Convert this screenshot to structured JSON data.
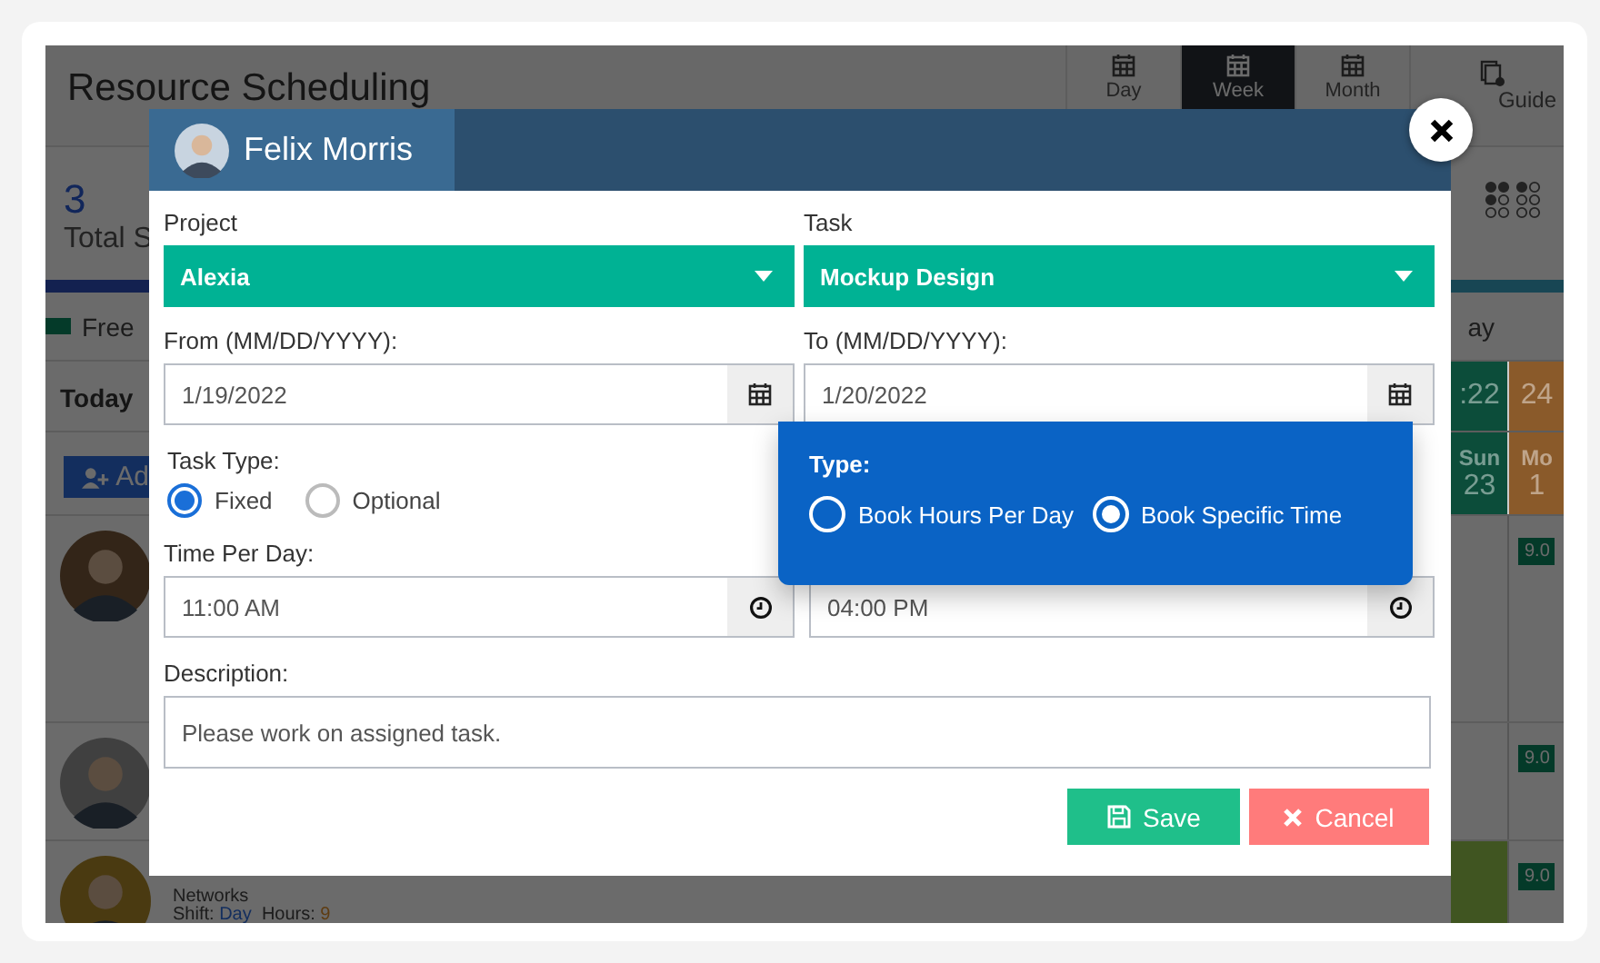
{
  "page": {
    "title": "Resource Scheduling",
    "views": [
      {
        "label": "Day",
        "selected": false
      },
      {
        "label": "Week",
        "selected": true
      },
      {
        "label": "Month",
        "selected": false
      }
    ],
    "guide": "Guide",
    "total_count": "3",
    "total_label": "Total S",
    "legend_label": "Free",
    "legend_right": "ay",
    "today": "Today",
    "add_button": "Ad",
    "date_columns": [
      {
        "heading": ":22",
        "day": "Sun",
        "date": "23",
        "color": "#0c4d3a"
      },
      {
        "heading": "24",
        "day": "Mo",
        "date": "1",
        "color": "#8a5a2a"
      }
    ],
    "resources": [
      {
        "tag": "9.0"
      },
      {
        "tag": "9.0"
      },
      {
        "team": "Networks",
        "shift_label": "Shift:",
        "shift": "Day",
        "hours_label": "Hours:",
        "hours": "9",
        "tag": "9.0"
      }
    ]
  },
  "modal": {
    "user": "Felix Morris",
    "project": {
      "label": "Project",
      "value": "Alexia"
    },
    "task": {
      "label": "Task",
      "value": "Mockup Design"
    },
    "from": {
      "label": "From (MM/DD/YYYY):",
      "value": "1/19/2022"
    },
    "to": {
      "label": "To (MM/DD/YYYY):",
      "value": "1/20/2022"
    },
    "task_type": {
      "label": "Task Type:",
      "options": [
        {
          "label": "Fixed",
          "selected": true
        },
        {
          "label": "Optional",
          "selected": false
        }
      ]
    },
    "time_per_day": {
      "label": "Time Per Day:",
      "start": "11:00 AM",
      "end": "04:00 PM"
    },
    "description": {
      "label": "Description:",
      "value": "Please work on assigned task."
    },
    "buttons": [
      {
        "label": "Save",
        "kind": "save"
      },
      {
        "label": "Cancel",
        "kind": "cancel"
      }
    ]
  },
  "type_popup": {
    "label": "Type:",
    "options": [
      {
        "label": "Book Hours Per Day",
        "selected": false
      },
      {
        "label": "Book Specific Time",
        "selected": true
      }
    ]
  }
}
